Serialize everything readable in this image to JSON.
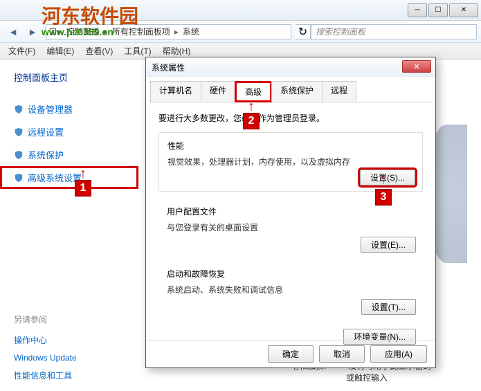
{
  "watermark": {
    "main": "河东软件园",
    "url": "www.pc0359.cn"
  },
  "breadcrumbs": {
    "items": [
      "控制面板",
      "所有控制面板项",
      "系统"
    ]
  },
  "search": {
    "placeholder": "搜索控制面板"
  },
  "menu": {
    "file": "文件(F)",
    "edit": "编辑(E)",
    "view": "查看(V)",
    "tools": "工具(T)",
    "help": "帮助(H)"
  },
  "sidebar": {
    "title": "控制面板主页",
    "items": [
      {
        "label": "设备管理器"
      },
      {
        "label": "远程设置"
      },
      {
        "label": "系统保护"
      },
      {
        "label": "高级系统设置"
      }
    ],
    "section_title": "另请参阅",
    "links": [
      "操作中心",
      "Windows Update",
      "性能信息和工具"
    ]
  },
  "dialog": {
    "title": "系统属性",
    "tabs": [
      "计算机名",
      "硬件",
      "高级",
      "系统保护",
      "远程"
    ],
    "intro": "要进行大多数更改，您必须作为管理员登录。",
    "groups": {
      "performance": {
        "title": "性能",
        "desc": "视觉效果，处理器计划，内存使用，以及虚拟内存",
        "btn": "设置(S)..."
      },
      "profile": {
        "title": "用户配置文件",
        "desc": "与您登录有关的桌面设置",
        "btn": "设置(E)..."
      },
      "recovery": {
        "title": "启动和故障恢复",
        "desc": "系统启动、系统失败和调试信息",
        "btn": "设置(T)..."
      }
    },
    "env_btn": "环境变量(N)...",
    "footer": {
      "ok": "确定",
      "cancel": "取消",
      "apply": "应用(A)"
    }
  },
  "annotations": {
    "a1": "1",
    "a2": "2",
    "a3": "3"
  },
  "bg": {
    "pen_label": "笔和触摸:",
    "pen_value": "没有可用于此显示器的",
    "pen_value2": "或触控输入"
  }
}
